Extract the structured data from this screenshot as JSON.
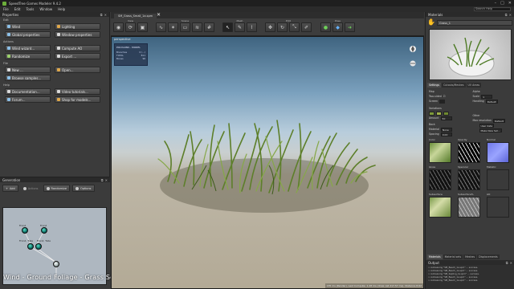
{
  "window": {
    "title": "SpeedTree Games Modeler 9.4.2",
    "buttons": [
      "–",
      "□",
      "✕"
    ]
  },
  "menu": {
    "items": [
      "File",
      "Edit",
      "Tools",
      "Window",
      "Help"
    ],
    "search_placeholder": "Search Help"
  },
  "properties": {
    "header": "Properties",
    "sections": [
      {
        "label": "Edit",
        "buttons": [
          {
            "label": "Wind",
            "icon": "wind-icon"
          },
          {
            "label": "Lighting",
            "icon": "lighting-icon"
          },
          {
            "label": "Global properties",
            "icon": "globe-icon"
          },
          {
            "label": "Window properties",
            "icon": "window-icon"
          }
        ]
      },
      {
        "label": "Actions",
        "buttons": [
          {
            "label": "Wind wizard...",
            "icon": "wind-wizard-icon"
          },
          {
            "label": "Compute AO",
            "icon": "ao-icon"
          },
          {
            "label": "Randomize",
            "icon": "randomize-icon"
          },
          {
            "label": "Export ...",
            "icon": "export-icon"
          }
        ]
      },
      {
        "label": "File",
        "buttons": [
          {
            "label": "New ...",
            "icon": "new-file-icon"
          },
          {
            "label": "Open...",
            "icon": "open-folder-icon"
          },
          {
            "label": "Browse samples...",
            "icon": "browse-icon"
          }
        ]
      },
      {
        "label": "Help",
        "buttons": [
          {
            "label": "Documentation...",
            "icon": "documentation-icon"
          },
          {
            "label": "Video tutorials...",
            "icon": "video-icon"
          },
          {
            "label": "Forum...",
            "icon": "forum-icon"
          },
          {
            "label": "Shop for models...",
            "icon": "shop-icon"
          }
        ]
      }
    ]
  },
  "generation": {
    "header": "Generation",
    "toolbar": [
      "Add",
      "Actions",
      "Randomize",
      "Options"
    ],
    "nodes": [
      "Frond",
      "Frond",
      "Frond, Tuile",
      "Frond, Tuile"
    ]
  },
  "caption": "Wind -  Ground Foliage - Grass Setup",
  "document": {
    "tab_label": "SM_Grass_Small_1a.spm"
  },
  "toolbar_groups": [
    "View",
    "Scene",
    "Mesh",
    "Edit",
    "Pose"
  ],
  "viewport": {
    "label": "perspective",
    "stats_title": "POLYGONS - MODEL",
    "stats": [
      {
        "label": "Branches",
        "value": "0 (...)"
      },
      {
        "label": "TOTAL",
        "value": "811"
      },
      {
        "label": "Bones",
        "value": "96"
      }
    ],
    "status": "135 ms (Render), Last Compute: 1.28 ms (draw call 217.57 ms), Distance 8.62"
  },
  "materials": {
    "header": "Materials",
    "selected": "Grass_1",
    "tabs": [
      "Settings",
      "Cutouts/Meshes",
      "UV Areas"
    ],
    "props": {
      "map_label": "Map",
      "two_sided_label": "Two-sided",
      "screen_label": "Screen",
      "alpha_label": "Alpha",
      "scale_label": "Scale",
      "scale_value": "1",
      "handling_label": "Handling",
      "handling_value": "Default",
      "variations_label": "Variations",
      "amount_label": "Amount",
      "amount_value": "50",
      "back_label": "Back",
      "material_label": "Material",
      "material_value": "None",
      "spacing_label": "Spacing",
      "spacing_value": "0.00",
      "other_label": "Other",
      "max_res_label": "Max resolution",
      "max_res_value": "Default",
      "user_data_label": "User data",
      "make_new_btn": "Make New Set..."
    },
    "texture_slots": [
      "Color",
      "Opacity",
      "Normal",
      "Gloss",
      "Specular",
      "Metallic",
      "Subsurface",
      "Subsurface%",
      "AO"
    ],
    "bottom_tabs": [
      "Materials",
      "Material sets",
      "Meshes",
      "Displacements"
    ]
  },
  "output": {
    "header": "Output",
    "lines": [
      "> Autosaving \"SM_Beech_1a.spm\" ... success.",
      "> Autosaving \"SM_Beech_1a.spm\" ... success.",
      "> Autosaving \"SM_Sapling_1a.spm\" ... success.",
      "> Autosaving \"SM_Beech_1a.spm\" ... success.",
      "> Autosaving \"SM_Beech_1a.spm\" ... success."
    ]
  }
}
